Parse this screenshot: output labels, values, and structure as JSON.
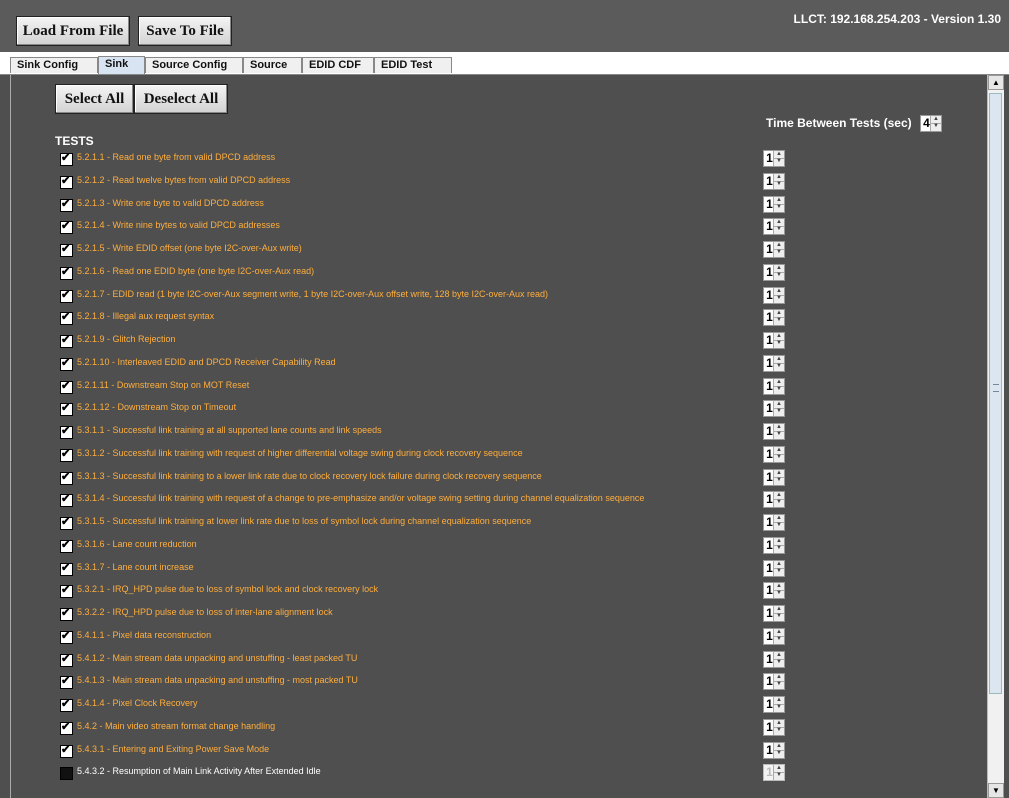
{
  "toolbar": {
    "load_label": "Load From File",
    "save_label": "Save To File",
    "version": "LLCT: 192.168.254.203 - Version 1.30"
  },
  "tabs": [
    {
      "label": "Sink Config",
      "active": false
    },
    {
      "label": "Sink",
      "active": true
    },
    {
      "label": "Source Config",
      "active": false
    },
    {
      "label": "Source",
      "active": false
    },
    {
      "label": "EDID CDF",
      "active": false
    },
    {
      "label": "EDID Test",
      "active": false
    }
  ],
  "panel": {
    "select_all_label": "Select All",
    "deselect_all_label": "Deselect All",
    "tests_title": "TESTS",
    "time_between_tests_label": "Time Between Tests (sec)",
    "time_between_tests_value": "4"
  },
  "tests": [
    {
      "label": "5.2.1.1 - Read one byte from valid DPCD address",
      "checked": true,
      "count": "1"
    },
    {
      "label": "5.2.1.2 - Read twelve bytes from valid DPCD address",
      "checked": true,
      "count": "1"
    },
    {
      "label": "5.2.1.3 - Write one byte to valid DPCD address",
      "checked": true,
      "count": "1"
    },
    {
      "label": "5.2.1.4 - Write nine bytes to valid DPCD addresses",
      "checked": true,
      "count": "1"
    },
    {
      "label": "5.2.1.5 - Write EDID offset (one byte I2C-over-Aux write)",
      "checked": true,
      "count": "1"
    },
    {
      "label": "5.2.1.6 - Read one EDID byte (one byte I2C-over-Aux read)",
      "checked": true,
      "count": "1"
    },
    {
      "label": "5.2.1.7 - EDID read (1 byte I2C-over-Aux segment write, 1 byte I2C-over-Aux offset write, 128 byte I2C-over-Aux read)",
      "checked": true,
      "count": "1"
    },
    {
      "label": "5.2.1.8 - Illegal aux request syntax",
      "checked": true,
      "count": "1"
    },
    {
      "label": "5.2.1.9 - Glitch Rejection",
      "checked": true,
      "count": "1"
    },
    {
      "label": "5.2.1.10 - Interleaved EDID and DPCD Receiver Capability Read",
      "checked": true,
      "count": "1"
    },
    {
      "label": "5.2.1.11 - Downstream Stop on MOT Reset",
      "checked": true,
      "count": "1"
    },
    {
      "label": "5.2.1.12 - Downstream Stop on Timeout",
      "checked": true,
      "count": "1"
    },
    {
      "label": "5.3.1.1 - Successful link training at all supported lane counts and link speeds",
      "checked": true,
      "count": "1"
    },
    {
      "label": "5.3.1.2 - Successful link training with request of higher differential voltage swing during clock recovery sequence",
      "checked": true,
      "count": "1"
    },
    {
      "label": "5.3.1.3 - Successful link training to a lower link rate due to clock recovery lock failure during clock recovery sequence",
      "checked": true,
      "count": "1"
    },
    {
      "label": "5.3.1.4 - Successful link training with request of a change to pre-emphasize and/or voltage swing setting during channel equalization sequence",
      "checked": true,
      "count": "1"
    },
    {
      "label": "5.3.1.5 - Successful link training at lower link rate due to loss of symbol lock during channel equalization sequence",
      "checked": true,
      "count": "1"
    },
    {
      "label": "5.3.1.6 - Lane count reduction",
      "checked": true,
      "count": "1"
    },
    {
      "label": "5.3.1.7 - Lane count increase",
      "checked": true,
      "count": "1"
    },
    {
      "label": "5.3.2.1 - IRQ_HPD pulse due to loss of symbol lock and clock recovery lock",
      "checked": true,
      "count": "1"
    },
    {
      "label": "5.3.2.2 - IRQ_HPD pulse due to loss of inter-lane alignment lock",
      "checked": true,
      "count": "1"
    },
    {
      "label": "5.4.1.1 - Pixel data reconstruction",
      "checked": true,
      "count": "1"
    },
    {
      "label": "5.4.1.2 - Main stream data unpacking and unstuffing - least packed TU",
      "checked": true,
      "count": "1"
    },
    {
      "label": "5.4.1.3 - Main stream data unpacking and unstuffing - most packed TU",
      "checked": true,
      "count": "1"
    },
    {
      "label": "5.4.1.4 - Pixel Clock Recovery",
      "checked": true,
      "count": "1"
    },
    {
      "label": "5.4.2   - Main video stream format change handling",
      "checked": true,
      "count": "1"
    },
    {
      "label": "5.4.3.1 - Entering and Exiting Power Save Mode",
      "checked": true,
      "count": "1"
    },
    {
      "label": "5.4.3.2 - Resumption of Main Link Activity After Extended Idle",
      "checked": false,
      "count": "1"
    }
  ],
  "icons": {
    "scroll_up": "up-arrow-icon",
    "scroll_down": "down-arrow-icon"
  }
}
